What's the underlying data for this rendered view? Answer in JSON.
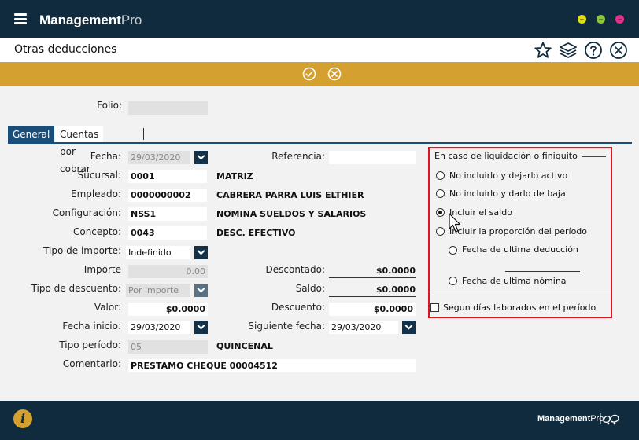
{
  "app": {
    "brand_bold": "Management",
    "brand_light": "Pro"
  },
  "page": {
    "title": "Otras deducciones"
  },
  "header_icons": [
    "star-icon",
    "layers-icon",
    "help-icon",
    "close-circle-icon"
  ],
  "actions": [
    "check-icon",
    "cancel-icon"
  ],
  "folio": {
    "label": "Folio:",
    "value": ""
  },
  "tabs": [
    {
      "label": "General",
      "active": true
    },
    {
      "label": "Cuentas por cobrar",
      "active": false
    }
  ],
  "form": {
    "fecha": {
      "label": "Fecha:",
      "value": "29/03/2020"
    },
    "referencia": {
      "label": "Referencia:",
      "value": ""
    },
    "sucursal": {
      "label": "Sucursal:",
      "code": "0001",
      "name": "MATRIZ"
    },
    "empleado": {
      "label": "Empleado:",
      "code": "0000000002",
      "name": "CABRERA PARRA LUIS ELTHIER"
    },
    "configuracion": {
      "label": "Configuración:",
      "code": "NSS1",
      "name": "NOMINA SUELDOS Y SALARIOS"
    },
    "concepto": {
      "label": "Concepto:",
      "code": "0043",
      "name": "DESC. EFECTIVO"
    },
    "tipo_importe": {
      "label": "Tipo de importe:",
      "value": "Indefinido"
    },
    "importe": {
      "label": "Importe",
      "value": "0.00"
    },
    "descontado": {
      "label": "Descontado:",
      "value": "$0.0000"
    },
    "tipo_descuento": {
      "label": "Tipo de descuento:",
      "value": "Por importe"
    },
    "saldo": {
      "label": "Saldo:",
      "value": "$0.0000"
    },
    "valor": {
      "label": "Valor:",
      "value": "$0.0000"
    },
    "descuento": {
      "label": "Descuento:",
      "value": "$0.0000"
    },
    "fecha_inicio": {
      "label": "Fecha inicio:",
      "value": "29/03/2020"
    },
    "siguiente_fecha": {
      "label": "Siguiente fecha:",
      "value": "29/03/2020"
    },
    "tipo_periodo": {
      "label": "Tipo período:",
      "code": "05",
      "name": "QUINCENAL"
    },
    "comentario": {
      "label": "Comentario:",
      "value": "PRESTAMO CHEQUE 00004512"
    }
  },
  "liquidacion": {
    "legend": "En caso de liquidación o finiquito",
    "options": [
      {
        "label": "No incluirlo y dejarlo activo",
        "checked": false
      },
      {
        "label": "No incluirlo y darlo de baja",
        "checked": false
      },
      {
        "label": "Incluir el saldo",
        "checked": true
      },
      {
        "label": "Incluir la proporción del período",
        "checked": false
      }
    ],
    "sub_options": [
      {
        "label": "Fecha de ultima deducción",
        "checked": false
      },
      {
        "label": "Fecha de ultima nómina",
        "checked": false
      }
    ],
    "checkbox_label": "Segun días laborados en el período",
    "checkbox_checked": false
  },
  "footer": {
    "brand_bold": "Management",
    "brand_light": "Pro"
  },
  "colors": {
    "navy": "#0f2b3d",
    "gold": "#d4a130",
    "tab_blue": "#1a4e79",
    "highlight_red": "#e0141e"
  }
}
